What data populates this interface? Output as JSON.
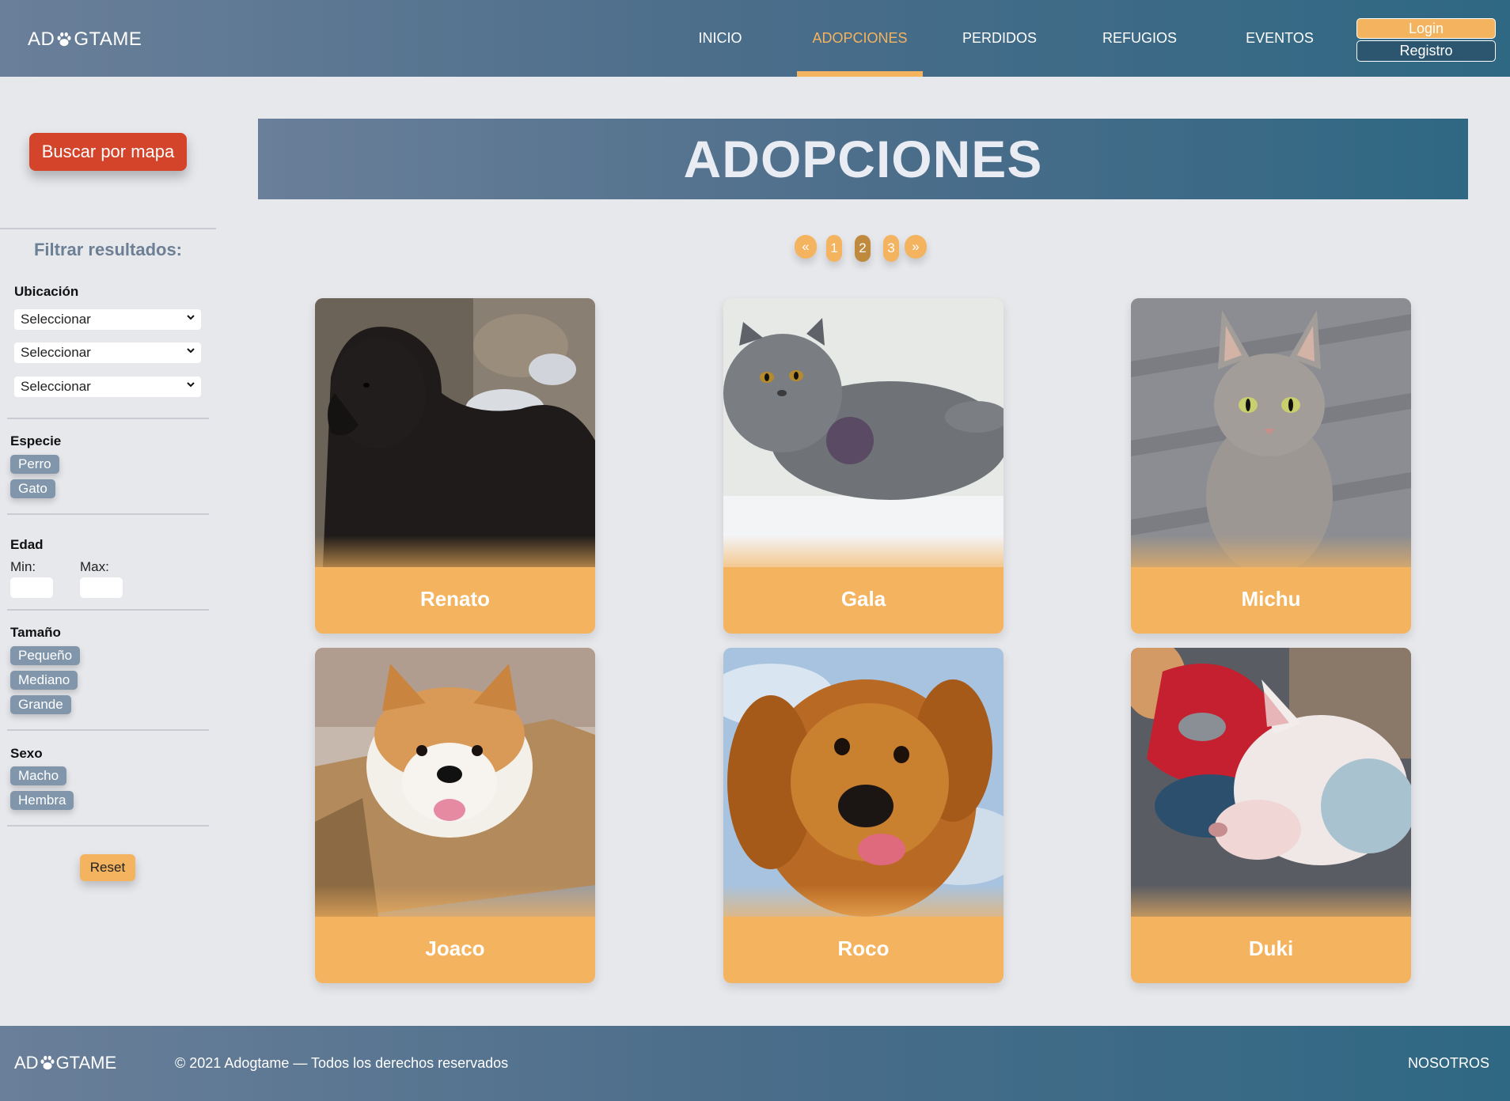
{
  "header": {
    "logo_left": "AD",
    "logo_right": "GTAME",
    "nav": [
      "INICIO",
      "ADOPCIONES",
      "PERDIDOS",
      "REFUGIOS",
      "EVENTOS"
    ],
    "active_nav": "ADOPCIONES",
    "login_label": "Login",
    "register_label": "Registro"
  },
  "sidebar": {
    "map_button": "Buscar por mapa",
    "filter_title": "Filtrar resultados:",
    "location_label": "Ubicación",
    "selects": [
      "Seleccionar",
      "Seleccionar",
      "Seleccionar"
    ],
    "species_label": "Especie",
    "species": [
      "Perro",
      "Gato"
    ],
    "age_label": "Edad",
    "age_min": "Min:",
    "age_max": "Max:",
    "size_label": "Tamaño",
    "sizes": [
      "Pequeño",
      "Mediano",
      "Grande"
    ],
    "sex_label": "Sexo",
    "sexes": [
      "Macho",
      "Hembra"
    ],
    "reset": "Reset"
  },
  "main": {
    "title": "ADOPCIONES",
    "pager": {
      "prev": "«",
      "pages": [
        "1",
        "2",
        "3"
      ],
      "current": "2",
      "next": "»"
    },
    "pets": [
      {
        "name": "Renato",
        "photo": "black-shar-pei-dog-photo"
      },
      {
        "name": "Gala",
        "photo": "gray-persian-cat-photo"
      },
      {
        "name": "Michu",
        "photo": "gray-tabby-cat-photo"
      },
      {
        "name": "Joaco",
        "photo": "shiba-inu-in-box-photo"
      },
      {
        "name": "Roco",
        "photo": "golden-retriever-photo"
      },
      {
        "name": "Duki",
        "photo": "white-bull-terrier-photo"
      }
    ]
  },
  "footer": {
    "logo_left": "AD",
    "logo_right": "GTAME",
    "copyright": "© 2021 Adogtame — Todos los derechos reservados",
    "link": "NOSOTROS"
  },
  "colors": {
    "accent": "#f4b35f",
    "header": "#4a6d8a",
    "map_button": "#d4442a",
    "chip": "#8195ab"
  }
}
